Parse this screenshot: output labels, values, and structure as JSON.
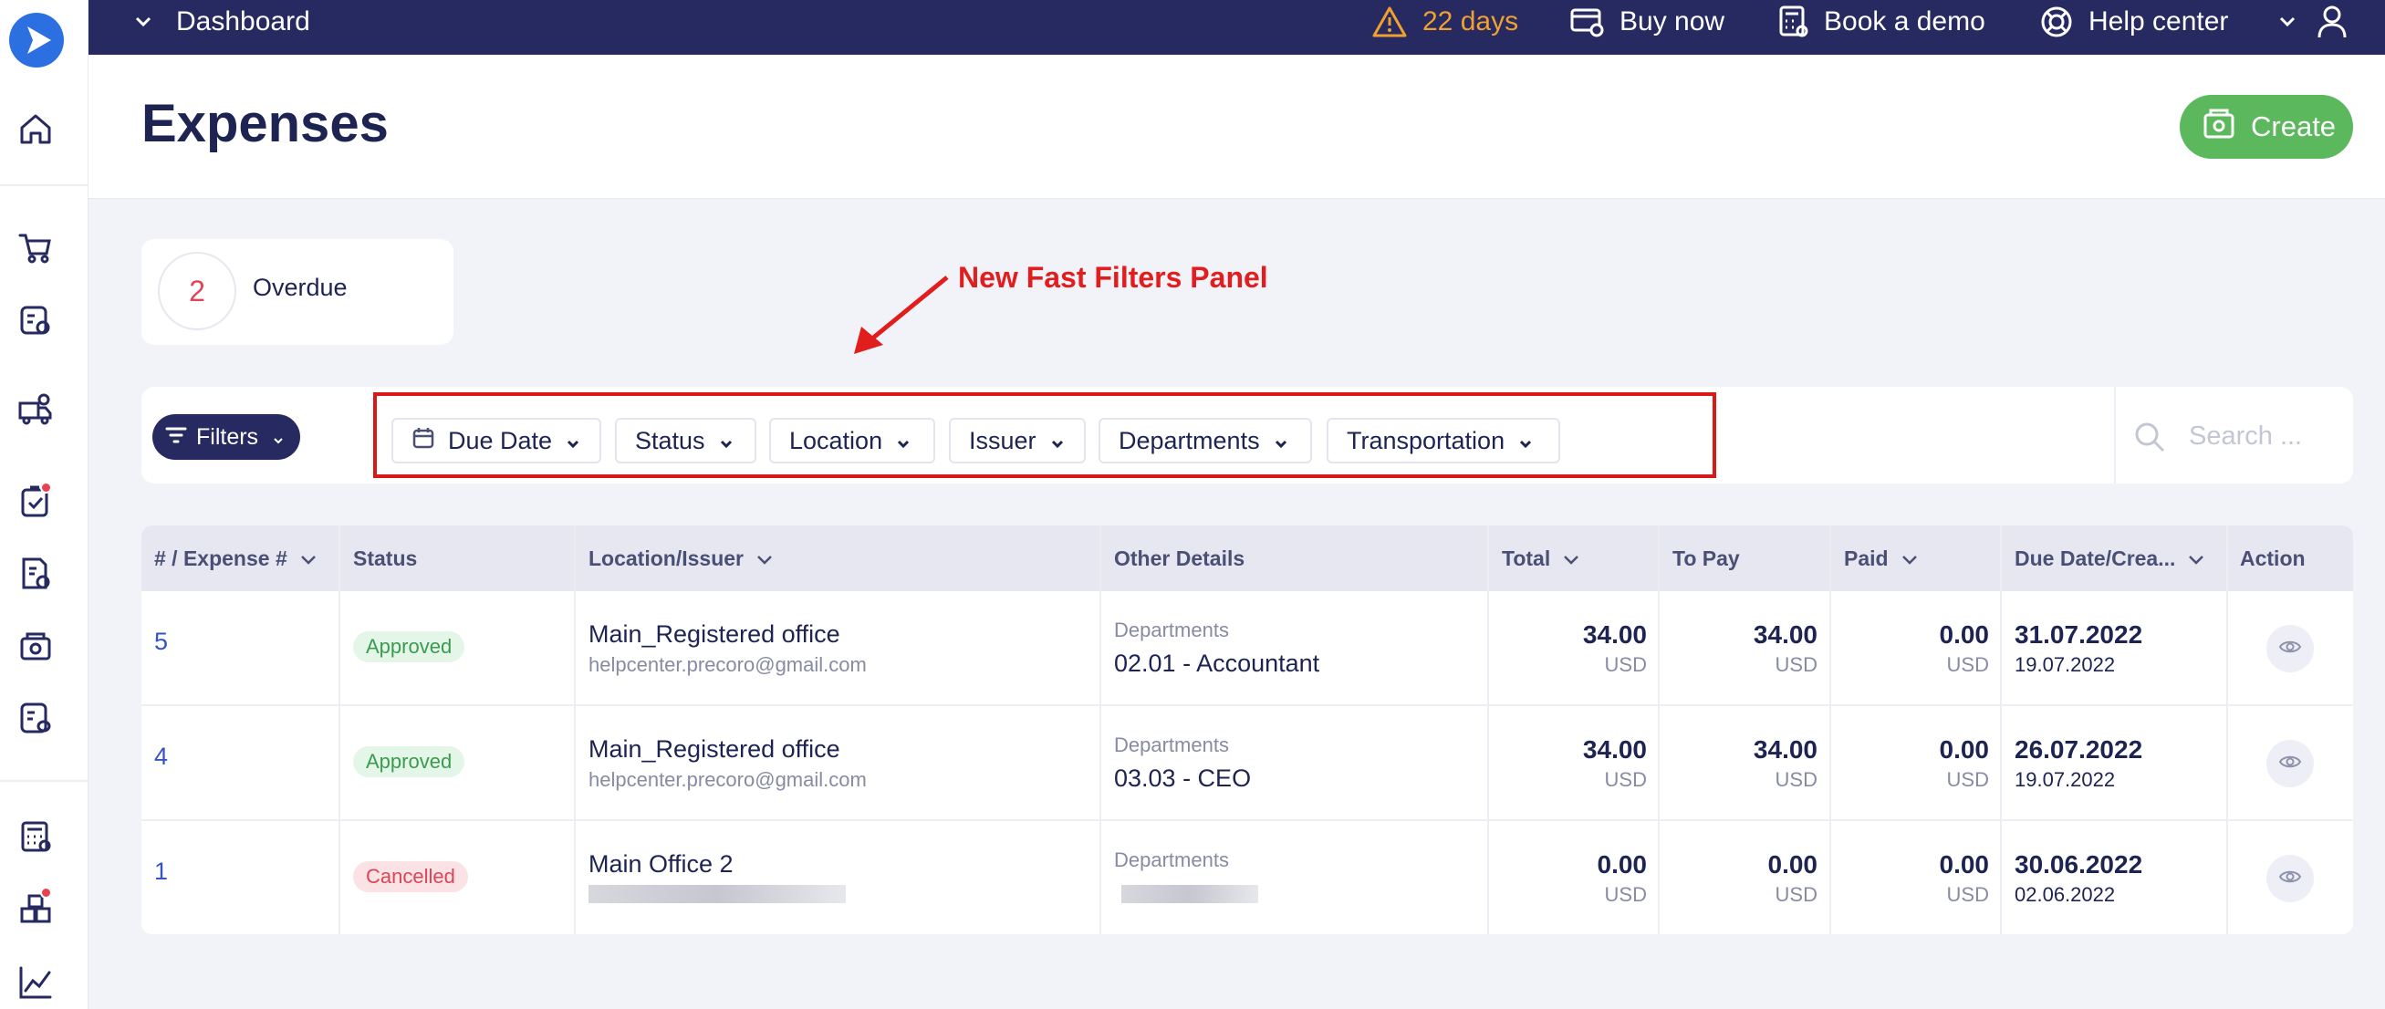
{
  "topbar": {
    "nav_label": "Dashboard",
    "trial_days": "22 days",
    "buy_now": "Buy now",
    "book_demo": "Book a demo",
    "help_center": "Help center",
    "colors": {
      "bar": "#262a61",
      "warning": "#f0a030"
    }
  },
  "page": {
    "title": "Expenses",
    "create_label": "Create"
  },
  "overdue": {
    "count": "2",
    "label": "Overdue"
  },
  "annotation": "New Fast Filters Panel",
  "filters": {
    "button_label": "Filters",
    "chips": [
      "Due Date",
      "Status",
      "Location",
      "Issuer",
      "Departments",
      "Transportation"
    ],
    "search_placeholder": "Search ..."
  },
  "table": {
    "headers": [
      "# / Expense #",
      "Status",
      "Location/Issuer",
      "Other Details",
      "Total",
      "To Pay",
      "Paid",
      "Due Date/Crea...",
      "Action"
    ],
    "rows": [
      {
        "id": "5",
        "status": "Approved",
        "location": "Main_Registered office",
        "issuer": "helpcenter.precoro@gmail.com",
        "detail_label": "Departments",
        "detail_value": "02.01 - Accountant",
        "total": "34.00",
        "to_pay": "34.00",
        "paid": "0.00",
        "currency": "USD",
        "due_date": "31.07.2022",
        "created": "19.07.2022"
      },
      {
        "id": "4",
        "status": "Approved",
        "location": "Main_Registered office",
        "issuer": "helpcenter.precoro@gmail.com",
        "detail_label": "Departments",
        "detail_value": "03.03 - CEO",
        "total": "34.00",
        "to_pay": "34.00",
        "paid": "0.00",
        "currency": "USD",
        "due_date": "26.07.2022",
        "created": "19.07.2022"
      },
      {
        "id": "1",
        "status": "Cancelled",
        "location": "Main Office 2",
        "detail_label": "Departments",
        "total": "0.00",
        "to_pay": "0.00",
        "paid": "0.00",
        "currency": "USD",
        "due_date": "30.06.2022",
        "created": "02.06.2022"
      }
    ]
  },
  "sidebar_icons": [
    "home-icon",
    "cart-icon",
    "requests-icon",
    "delivery-icon",
    "approvals-icon",
    "invoice-icon",
    "expenses-icon",
    "budget-icon",
    "calculator-icon",
    "boxes-icon",
    "analytics-icon"
  ]
}
